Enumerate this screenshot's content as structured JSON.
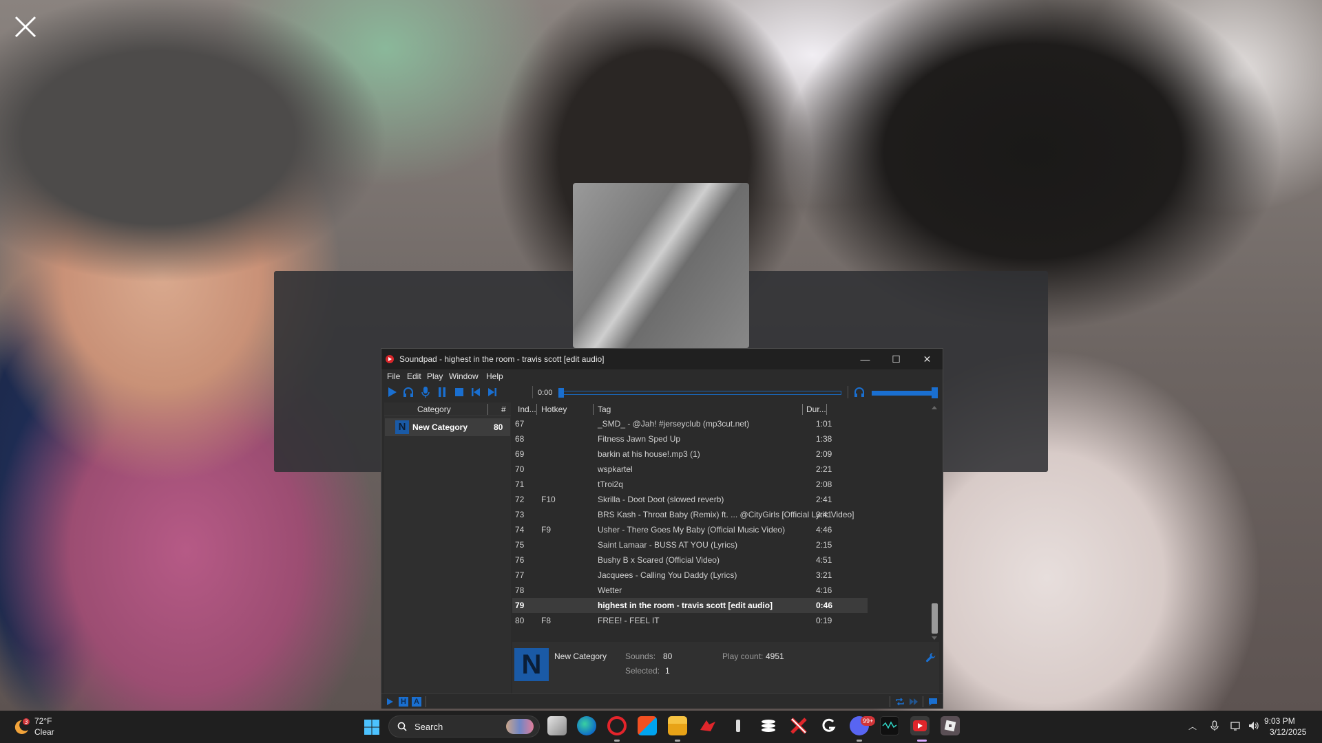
{
  "window": {
    "title": "Soundpad - highest in the room - travis scott [edit audio]",
    "minimize": "—",
    "maximize": "☐",
    "close": "✕"
  },
  "menu": [
    "File",
    "Edit",
    "Play",
    "Window",
    "Help"
  ],
  "toolbar": {
    "time": "0:00",
    "progress": 0,
    "volume": 0.95
  },
  "categories": {
    "headers": {
      "category": "Category",
      "count": "#"
    },
    "items": [
      {
        "icon_letter": "N",
        "name": "New Category",
        "count": "80"
      }
    ]
  },
  "list": {
    "headers": {
      "index": "Ind...",
      "hotkey": "Hotkey",
      "tag": "Tag",
      "duration": "Dur..."
    },
    "rows": [
      {
        "index": "67",
        "hotkey": "",
        "tag": "_SMD_ - @Jah! #jerseyclub (mp3cut.net)",
        "duration": "1:01"
      },
      {
        "index": "68",
        "hotkey": "",
        "tag": "Fitness Jawn Sped Up",
        "duration": "1:38"
      },
      {
        "index": "69",
        "hotkey": "",
        "tag": "barkin at his house!.mp3 (1)",
        "duration": "2:09"
      },
      {
        "index": "70",
        "hotkey": "",
        "tag": "wspkartel",
        "duration": "2:21"
      },
      {
        "index": "71",
        "hotkey": "",
        "tag": "tTroi2q",
        "duration": "2:08"
      },
      {
        "index": "72",
        "hotkey": "F10",
        "tag": "Skrilla - Doot Doot  (slowed  reverb)",
        "duration": "2:41"
      },
      {
        "index": "73",
        "hotkey": "",
        "tag": "BRS Kash - Throat Baby (Remix) ft. ... @CityGirls [Official Lyric Video]",
        "duration": "3:41"
      },
      {
        "index": "74",
        "hotkey": "F9",
        "tag": "Usher - There Goes My Baby (Official Music Video)",
        "duration": "4:46"
      },
      {
        "index": "75",
        "hotkey": "",
        "tag": "Saint Lamaar - BUSS AT YOU (Lyrics)",
        "duration": "2:15"
      },
      {
        "index": "76",
        "hotkey": "",
        "tag": "Bushy B x Scared (Official Video)",
        "duration": "4:51"
      },
      {
        "index": "77",
        "hotkey": "",
        "tag": "Jacquees - Calling You Daddy  (Lyrics)",
        "duration": "3:21"
      },
      {
        "index": "78",
        "hotkey": "",
        "tag": "Wetter",
        "duration": "4:16"
      },
      {
        "index": "79",
        "hotkey": "",
        "tag": "highest in the room - travis scott [edit audio]",
        "duration": "0:46",
        "selected": true
      },
      {
        "index": "80",
        "hotkey": "F8",
        "tag": "FREE! - FEEL IT",
        "duration": "0:19"
      }
    ]
  },
  "info": {
    "icon_letter": "N",
    "name": "New Category",
    "sounds_label": "Sounds:",
    "sounds": "80",
    "selected_label": "Selected:",
    "selected": "1",
    "playcount_label": "Play count:",
    "playcount": "4951"
  },
  "statusbar": {
    "h_label": "H",
    "a_label": "A"
  },
  "taskbar": {
    "weather_temp": "72°F",
    "weather_cond": "Clear",
    "weather_badge": "3",
    "search_label": "Search",
    "discord_badge": "99+",
    "time": "9:03 PM",
    "date": "3/12/2025"
  },
  "colors": {
    "accent": "#1a6fd0",
    "window_bg": "#2b2b2b",
    "taskbar_bg": "#1f1f1f"
  }
}
